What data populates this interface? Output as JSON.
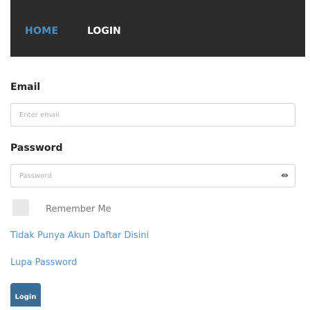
{
  "nav": {
    "home_label": "HOME",
    "login_label": "LOGIN",
    "background_color": "#2c2c2c",
    "home_color": "#4a90c8"
  },
  "form": {
    "email": {
      "label": "Email",
      "placeholder": "Enter email",
      "value": ""
    },
    "password": {
      "label": "Password",
      "placeholder": "Password",
      "value": "",
      "toggle_icon": "eye-icon"
    },
    "remember_me": {
      "label": "Remember Me",
      "checked": false
    },
    "register_link": "Tidak Punya Akun Daftar Disini",
    "forgot_link": "Lupa Password",
    "submit_label": "Login",
    "submit_color": "#3a6e96"
  }
}
